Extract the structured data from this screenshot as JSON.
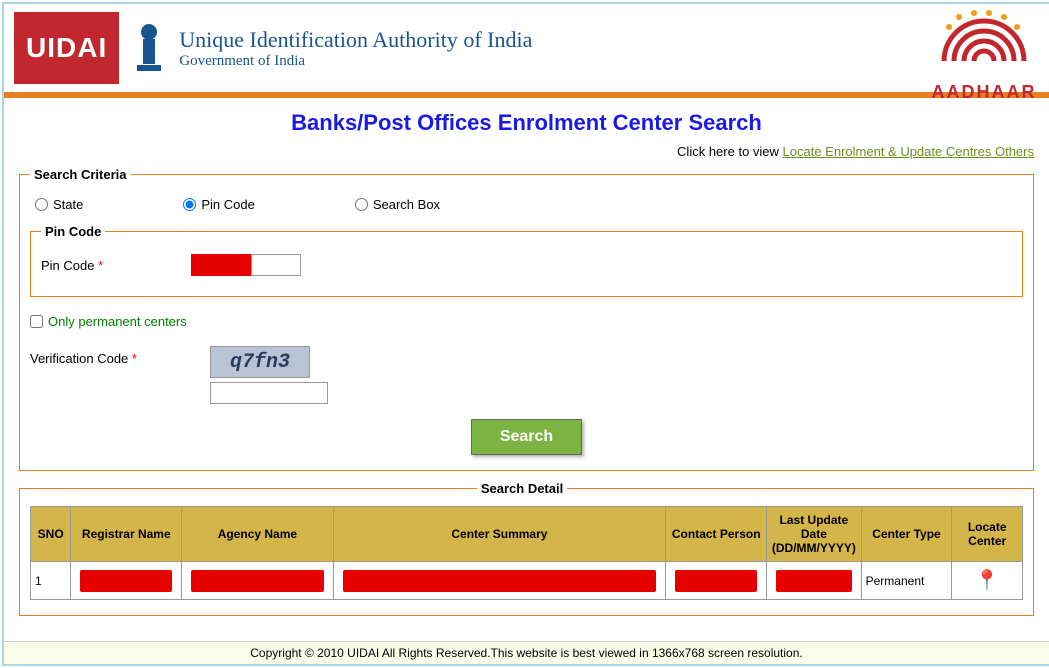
{
  "header": {
    "logo_text": "UIDAI",
    "title": "Unique Identification Authority of India",
    "subtitle": "Government of India",
    "aadhaar_label": "AADHAAR"
  },
  "page": {
    "title": "Banks/Post Offices Enrolment Center Search",
    "link_prefix": "Click here to view ",
    "link_text": "Locate Enrolment & Update Centres Others"
  },
  "search_criteria": {
    "legend": "Search Criteria",
    "radios": {
      "state": "State",
      "pincode": "Pin Code",
      "searchbox": "Search Box"
    },
    "pincode_legend": "Pin Code",
    "pincode_label": "Pin Code ",
    "permanent_label": "Only permanent centers",
    "verification_label": "Verification Code ",
    "captcha_text": "q7fn3",
    "search_button": "Search"
  },
  "search_detail": {
    "legend": "Search Detail",
    "columns": {
      "sno": "SNO",
      "registrar": "Registrar Name",
      "agency": "Agency Name",
      "summary": "Center Summary",
      "contact": "Contact Person",
      "last_update": "Last Update Date (DD/MM/YYYY)",
      "center_type": "Center Type",
      "locate": "Locate Center"
    },
    "rows": [
      {
        "sno": "1",
        "center_type": "Permanent"
      }
    ]
  },
  "footer": {
    "text": "Copyright © 2010 UIDAI All Rights Reserved.This website is best viewed in 1366x768 screen resolution."
  }
}
